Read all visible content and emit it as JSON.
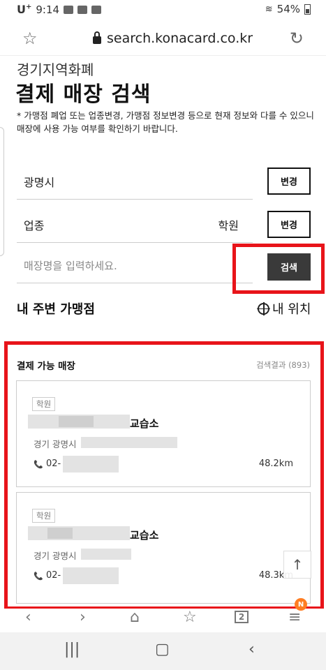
{
  "status_bar": {
    "carrier": "U",
    "carrier_sup": "+",
    "time": "9:14",
    "battery": "54%",
    "signal_label": "4G"
  },
  "browser": {
    "url": "search.konacard.co.kr",
    "star_icon": "☆",
    "reload_icon": "↻"
  },
  "page": {
    "subtitle": "경기지역화폐",
    "title": "결제 매장 검색",
    "notice": "* 가맹점 폐업 또는 업종변경, 가맹점 정보변경 등으로 현재 정보와 다를 수 있으니 매장에 사용 가능 여부를 확인하기 바랍니다."
  },
  "search_form": {
    "region_value": "광명시",
    "region_change_button": "변경",
    "category_label": "업종",
    "category_value": "학원",
    "category_change_button": "변경",
    "store_name_placeholder": "매장명을 입력하세요.",
    "search_button": "검색"
  },
  "nearby": {
    "title": "내 주변 가맹점",
    "my_location": "내 위치"
  },
  "results": {
    "heading": "결제 가능 매장",
    "count_text": "검색결과 (893)",
    "items": [
      {
        "category": "학원",
        "name_suffix": "교습소",
        "address_prefix": "경기 광명시",
        "phone_prefix": "02-",
        "distance": "48.2km"
      },
      {
        "category": "학원",
        "name_suffix": "교습소",
        "address_prefix": "경기 광명시",
        "phone_prefix": "02-",
        "distance": "48.3km"
      }
    ]
  },
  "bottom_nav": {
    "tabs_count": "2",
    "notification_badge": "N"
  },
  "colors": {
    "highlight_red": "#e8141a",
    "search_button_bg": "#3a3a3a",
    "badge_orange": "#ff7d22"
  }
}
